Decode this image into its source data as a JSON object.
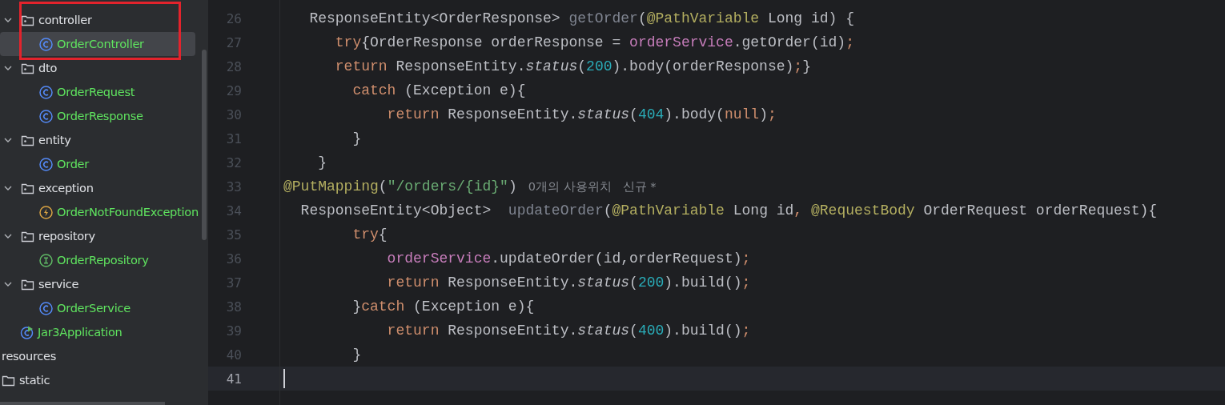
{
  "project_tree": {
    "items": [
      {
        "kind": "package",
        "label": "controller",
        "expanded": true,
        "selected": false,
        "children": [
          {
            "kind": "class",
            "label": "OrderController",
            "selected": true
          }
        ]
      },
      {
        "kind": "package",
        "label": "dto",
        "expanded": true,
        "selected": false,
        "children": [
          {
            "kind": "class",
            "label": "OrderRequest",
            "selected": false
          },
          {
            "kind": "class",
            "label": "OrderResponse",
            "selected": false
          }
        ]
      },
      {
        "kind": "package",
        "label": "entity",
        "expanded": true,
        "selected": false,
        "children": [
          {
            "kind": "class",
            "label": "Order",
            "selected": false
          }
        ]
      },
      {
        "kind": "package",
        "label": "exception",
        "expanded": true,
        "selected": false,
        "children": [
          {
            "kind": "exception",
            "label": "OrderNotFoundException",
            "selected": false
          }
        ]
      },
      {
        "kind": "package",
        "label": "repository",
        "expanded": true,
        "selected": false,
        "children": [
          {
            "kind": "interface",
            "label": "OrderRepository",
            "selected": false
          }
        ]
      },
      {
        "kind": "package",
        "label": "service",
        "expanded": true,
        "selected": false,
        "children": [
          {
            "kind": "class",
            "label": "OrderService",
            "selected": false
          }
        ]
      },
      {
        "kind": "application",
        "label": "Jar3Application",
        "selected": false
      }
    ],
    "resources": {
      "label": "resources",
      "children": [
        {
          "kind": "folder",
          "label": "static",
          "selected": false
        }
      ]
    }
  },
  "editor": {
    "lines": [
      {
        "number": "26",
        "current": false,
        "tokens": [
          {
            "kind": "plain",
            "text": "   ResponseEntity<OrderResponse> "
          },
          {
            "kind": "unused",
            "text": "getOrder"
          },
          {
            "kind": "plain",
            "text": "("
          },
          {
            "kind": "annotation",
            "text": "@PathVariable"
          },
          {
            "kind": "plain",
            "text": " Long id) {"
          }
        ]
      },
      {
        "number": "27",
        "current": false,
        "tokens": [
          {
            "kind": "keyword",
            "text": "      try"
          },
          {
            "kind": "plain",
            "text": "{OrderResponse orderResponse = "
          },
          {
            "kind": "field",
            "text": "orderService"
          },
          {
            "kind": "plain",
            "text": ".getOrder(id)"
          },
          {
            "kind": "keyword",
            "text": ";"
          }
        ]
      },
      {
        "number": "28",
        "current": false,
        "tokens": [
          {
            "kind": "keyword",
            "text": "      return"
          },
          {
            "kind": "plain",
            "text": " ResponseEntity."
          },
          {
            "kind": "static",
            "text": "status"
          },
          {
            "kind": "plain",
            "text": "("
          },
          {
            "kind": "number",
            "text": "200"
          },
          {
            "kind": "plain",
            "text": ").body(orderResponse)"
          },
          {
            "kind": "keyword",
            "text": ";"
          },
          {
            "kind": "plain",
            "text": "}"
          }
        ]
      },
      {
        "number": "29",
        "current": false,
        "tokens": [
          {
            "kind": "keyword",
            "text": "        catch"
          },
          {
            "kind": "plain",
            "text": " (Exception e){"
          }
        ]
      },
      {
        "number": "30",
        "current": false,
        "tokens": [
          {
            "kind": "keyword",
            "text": "            return"
          },
          {
            "kind": "plain",
            "text": " ResponseEntity."
          },
          {
            "kind": "static",
            "text": "status"
          },
          {
            "kind": "plain",
            "text": "("
          },
          {
            "kind": "number",
            "text": "404"
          },
          {
            "kind": "plain",
            "text": ").body("
          },
          {
            "kind": "keyword",
            "text": "null"
          },
          {
            "kind": "plain",
            "text": ")"
          },
          {
            "kind": "keyword",
            "text": ";"
          }
        ]
      },
      {
        "number": "31",
        "current": false,
        "tokens": [
          {
            "kind": "plain",
            "text": "        }"
          }
        ]
      },
      {
        "number": "32",
        "current": false,
        "tokens": [
          {
            "kind": "plain",
            "text": "    }"
          }
        ]
      },
      {
        "number": "33",
        "current": false,
        "tokens": [
          {
            "kind": "annotation",
            "text": "@PutMapping"
          },
          {
            "kind": "plain",
            "text": "("
          },
          {
            "kind": "string",
            "text": "\"/orders/{id}\""
          },
          {
            "kind": "plain",
            "text": ")"
          }
        ],
        "hints": [
          "0개의 사용위치",
          "신규 *"
        ]
      },
      {
        "number": "34",
        "current": false,
        "tokens": [
          {
            "kind": "plain",
            "text": "  ResponseEntity<Object>  "
          },
          {
            "kind": "unused",
            "text": "updateOrder"
          },
          {
            "kind": "plain",
            "text": "("
          },
          {
            "kind": "annotation",
            "text": "@PathVariable"
          },
          {
            "kind": "plain",
            "text": " Long id"
          },
          {
            "kind": "keyword",
            "text": ","
          },
          {
            "kind": "annotation",
            "text": " @RequestBody"
          },
          {
            "kind": "plain",
            "text": " OrderRequest orderRequest){"
          }
        ]
      },
      {
        "number": "35",
        "current": false,
        "tokens": [
          {
            "kind": "keyword",
            "text": "        try"
          },
          {
            "kind": "plain",
            "text": "{"
          }
        ]
      },
      {
        "number": "36",
        "current": false,
        "tokens": [
          {
            "kind": "field",
            "text": "            orderService"
          },
          {
            "kind": "plain",
            "text": ".updateOrder(id,orderRequest)"
          },
          {
            "kind": "keyword",
            "text": ";"
          }
        ]
      },
      {
        "number": "37",
        "current": false,
        "tokens": [
          {
            "kind": "keyword",
            "text": "            return"
          },
          {
            "kind": "plain",
            "text": " ResponseEntity."
          },
          {
            "kind": "static",
            "text": "status"
          },
          {
            "kind": "plain",
            "text": "("
          },
          {
            "kind": "number",
            "text": "200"
          },
          {
            "kind": "plain",
            "text": ").build()"
          },
          {
            "kind": "keyword",
            "text": ";"
          }
        ]
      },
      {
        "number": "38",
        "current": false,
        "tokens": [
          {
            "kind": "plain",
            "text": "        }"
          },
          {
            "kind": "keyword",
            "text": "catch"
          },
          {
            "kind": "plain",
            "text": " (Exception e){"
          }
        ]
      },
      {
        "number": "39",
        "current": false,
        "tokens": [
          {
            "kind": "keyword",
            "text": "            return"
          },
          {
            "kind": "plain",
            "text": " ResponseEntity."
          },
          {
            "kind": "static",
            "text": "status"
          },
          {
            "kind": "plain",
            "text": "("
          },
          {
            "kind": "number",
            "text": "400"
          },
          {
            "kind": "plain",
            "text": ").build()"
          },
          {
            "kind": "keyword",
            "text": ";"
          }
        ]
      },
      {
        "number": "40",
        "current": false,
        "tokens": [
          {
            "kind": "plain",
            "text": "        }"
          }
        ]
      },
      {
        "number": "41",
        "current": true
      }
    ]
  }
}
